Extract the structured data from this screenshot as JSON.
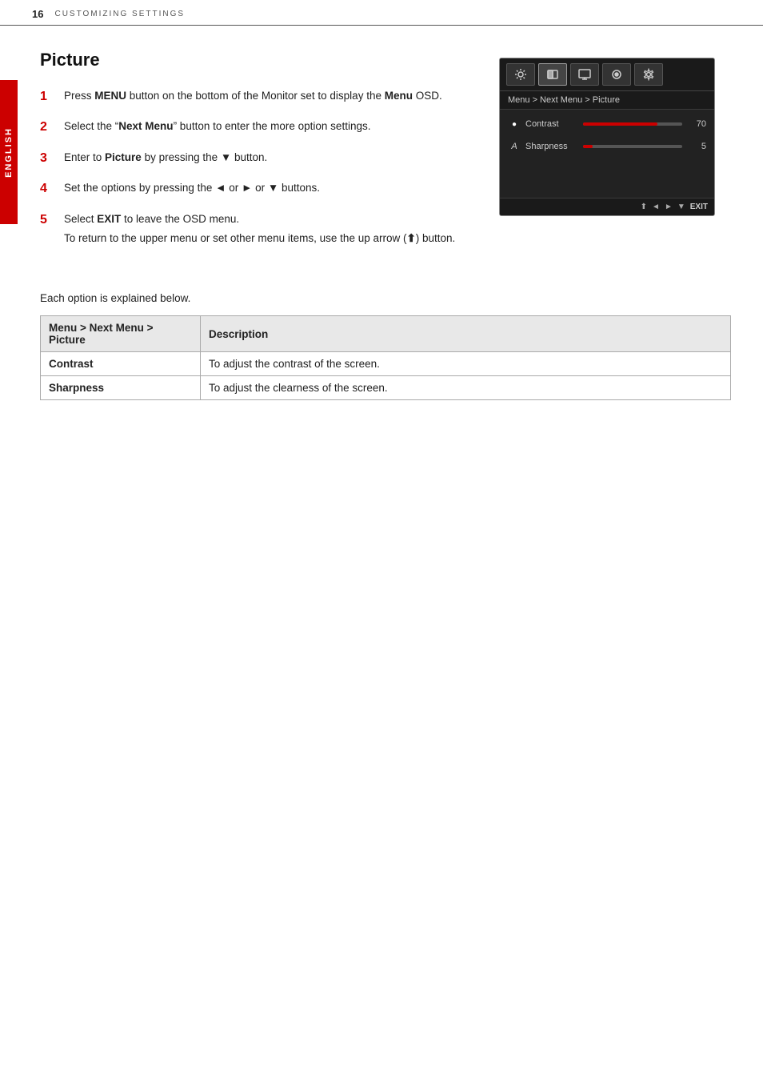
{
  "header": {
    "page_number": "16",
    "title": "CUSTOMIZING SETTINGS"
  },
  "sidebar": {
    "label": "ENGLISH"
  },
  "section": {
    "title": "Picture",
    "steps": [
      {
        "number": "1",
        "html": "Press <strong>MENU</strong> button on the bottom of the Monitor set to display the <strong>Menu</strong> OSD."
      },
      {
        "number": "2",
        "html": "Select the \"<strong>Next Menu</strong>\" button to enter the more option settings."
      },
      {
        "number": "3",
        "html": "Enter to <strong>Picture</strong> by pressing the ▼ button."
      },
      {
        "number": "4",
        "html": "Set the options by pressing the ◄ or ► or ▼ buttons."
      },
      {
        "number": "5",
        "main": "Select EXIT to leave the OSD menu.",
        "sub": "To return to the upper menu or set other menu items, use the up arrow (⇧) button."
      }
    ]
  },
  "osd": {
    "breadcrumb": "Menu  >  Next Menu  >  Picture",
    "rows": [
      {
        "icon": "●",
        "label": "Contrast",
        "fill_pct": 75,
        "value": "70"
      },
      {
        "icon": "A",
        "label": "Sharpness",
        "fill_pct": 10,
        "value": "5"
      }
    ],
    "bottom_controls": [
      "⇧",
      "◄",
      "►",
      "▼"
    ],
    "exit_label": "EXIT"
  },
  "options_section": {
    "intro": "Each option is explained below.",
    "table": {
      "col1_header": "Menu > Next Menu > Picture",
      "col2_header": "Description",
      "rows": [
        {
          "name": "Contrast",
          "description": "To adjust the contrast of the screen."
        },
        {
          "name": "Sharpness",
          "description": "To adjust the clearness of the screen."
        }
      ]
    }
  }
}
